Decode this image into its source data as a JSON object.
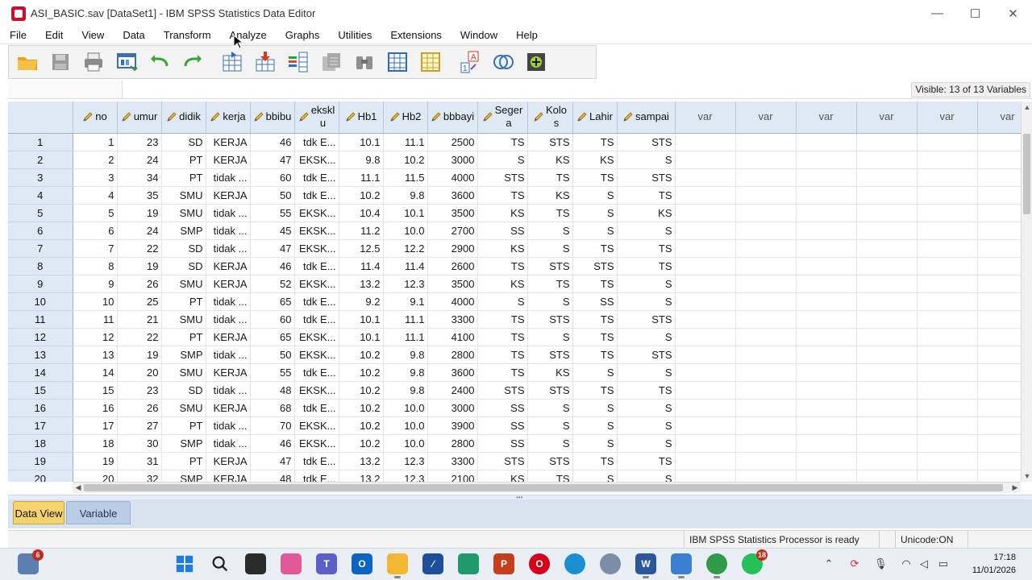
{
  "window": {
    "title": "ASI_BASIC.sav [DataSet1] - IBM SPSS Statistics Data Editor",
    "minimize": "—",
    "maximize": "☐",
    "close": "✕"
  },
  "menu": [
    "File",
    "Edit",
    "View",
    "Data",
    "Transform",
    "Analyze",
    "Graphs",
    "Utilities",
    "Extensions",
    "Window",
    "Help"
  ],
  "toolbar_icons": [
    "open-folder-icon",
    "save-icon",
    "print-icon",
    "dialog-recall-icon",
    "undo-icon",
    "redo-icon",
    "goto-case-icon",
    "goto-variable-icon",
    "variables-icon",
    "run-descriptives-icon",
    "find-icon",
    "insert-cases-icon",
    "insert-variable-icon",
    "split-file-icon",
    "value-labels-icon",
    "use-sets-icon",
    "customize-icon"
  ],
  "status": {
    "visible": "Visible: 13 of 13 Variables",
    "processor": "IBM SPSS Statistics Processor is ready",
    "unicode": "Unicode:ON"
  },
  "tabs": {
    "data_view": "Data View",
    "variable_view": "Variable View"
  },
  "columns": [
    {
      "name": "no",
      "line1": "no",
      "line2": ""
    },
    {
      "name": "umur",
      "line1": "umur",
      "line2": ""
    },
    {
      "name": "didik",
      "line1": "didik",
      "line2": ""
    },
    {
      "name": "kerja",
      "line1": "kerja",
      "line2": ""
    },
    {
      "name": "bbibu",
      "line1": "bbibu",
      "line2": ""
    },
    {
      "name": "ekskl",
      "line1": "ekskl",
      "line2": "u"
    },
    {
      "name": "Hb1",
      "line1": "Hb1",
      "line2": ""
    },
    {
      "name": "Hb2",
      "line1": "Hb2",
      "line2": ""
    },
    {
      "name": "bbbayi",
      "line1": "bbbayi",
      "line2": ""
    },
    {
      "name": "Segera",
      "line1": "Seger",
      "line2": "a"
    },
    {
      "name": "Kolos",
      "line1": "Kolo",
      "line2": "s"
    },
    {
      "name": "Lahir",
      "line1": "Lahir",
      "line2": ""
    },
    {
      "name": "sampai",
      "line1": "sampai",
      "line2": ""
    }
  ],
  "empty_col_label": "var",
  "rows": [
    [
      "1",
      "1",
      "23",
      "SD",
      "KERJA",
      "46",
      "tdk E...",
      "10.1",
      "11.1",
      "2500",
      "TS",
      "STS",
      "TS",
      "STS"
    ],
    [
      "2",
      "2",
      "24",
      "PT",
      "KERJA",
      "47",
      "EKSK...",
      "9.8",
      "10.2",
      "3000",
      "S",
      "KS",
      "KS",
      "S"
    ],
    [
      "3",
      "3",
      "34",
      "PT",
      "tidak ...",
      "60",
      "tdk E...",
      "11.1",
      "11.5",
      "4000",
      "STS",
      "TS",
      "TS",
      "STS"
    ],
    [
      "4",
      "4",
      "35",
      "SMU",
      "KERJA",
      "50",
      "tdk E...",
      "10.2",
      "9.8",
      "3600",
      "TS",
      "KS",
      "S",
      "TS"
    ],
    [
      "5",
      "5",
      "19",
      "SMU",
      "tidak ...",
      "55",
      "EKSK...",
      "10.4",
      "10.1",
      "3500",
      "KS",
      "TS",
      "S",
      "KS"
    ],
    [
      "6",
      "6",
      "24",
      "SMP",
      "tidak ...",
      "45",
      "EKSK...",
      "11.2",
      "10.0",
      "2700",
      "SS",
      "S",
      "S",
      "S"
    ],
    [
      "7",
      "7",
      "22",
      "SD",
      "tidak ...",
      "47",
      "EKSK...",
      "12.5",
      "12.2",
      "2900",
      "KS",
      "S",
      "TS",
      "TS"
    ],
    [
      "8",
      "8",
      "19",
      "SD",
      "KERJA",
      "46",
      "tdk E...",
      "11.4",
      "11.4",
      "2600",
      "TS",
      "STS",
      "STS",
      "TS"
    ],
    [
      "9",
      "9",
      "26",
      "SMU",
      "KERJA",
      "52",
      "EKSK...",
      "13.2",
      "12.3",
      "3500",
      "KS",
      "TS",
      "TS",
      "S"
    ],
    [
      "10",
      "10",
      "25",
      "PT",
      "tidak ...",
      "65",
      "tdk E...",
      "9.2",
      "9.1",
      "4000",
      "S",
      "S",
      "SS",
      "S"
    ],
    [
      "11",
      "11",
      "21",
      "SMU",
      "tidak ...",
      "60",
      "tdk E...",
      "10.1",
      "11.1",
      "3300",
      "TS",
      "STS",
      "TS",
      "STS"
    ],
    [
      "12",
      "12",
      "22",
      "PT",
      "KERJA",
      "65",
      "EKSK...",
      "10.1",
      "11.1",
      "4100",
      "TS",
      "S",
      "TS",
      "S"
    ],
    [
      "13",
      "13",
      "19",
      "SMP",
      "tidak ...",
      "50",
      "EKSK...",
      "10.2",
      "9.8",
      "2800",
      "TS",
      "STS",
      "TS",
      "STS"
    ],
    [
      "14",
      "14",
      "20",
      "SMU",
      "KERJA",
      "55",
      "tdk E...",
      "10.2",
      "9.8",
      "3600",
      "TS",
      "KS",
      "S",
      "S"
    ],
    [
      "15",
      "15",
      "23",
      "SD",
      "tidak ...",
      "48",
      "EKSK...",
      "10.2",
      "9.8",
      "2400",
      "STS",
      "STS",
      "TS",
      "TS"
    ],
    [
      "16",
      "16",
      "26",
      "SMU",
      "KERJA",
      "68",
      "tdk E...",
      "10.2",
      "10.0",
      "3000",
      "SS",
      "S",
      "S",
      "S"
    ],
    [
      "17",
      "17",
      "27",
      "PT",
      "tidak ...",
      "70",
      "EKSK...",
      "10.2",
      "10.0",
      "3900",
      "SS",
      "S",
      "S",
      "S"
    ],
    [
      "18",
      "18",
      "30",
      "SMP",
      "tidak ...",
      "46",
      "EKSK...",
      "10.2",
      "10.0",
      "2800",
      "SS",
      "S",
      "S",
      "S"
    ],
    [
      "19",
      "19",
      "31",
      "PT",
      "KERJA",
      "47",
      "tdk E...",
      "13.2",
      "12.3",
      "3300",
      "STS",
      "STS",
      "TS",
      "TS"
    ],
    [
      "20",
      "20",
      "32",
      "SMP",
      "KERJA",
      "48",
      "tdk E...",
      "13.2",
      "12.3",
      "2100",
      "KS",
      "TS",
      "S",
      "S"
    ]
  ],
  "taskbar": {
    "weather_badge": "6",
    "whatsapp_badge": "18",
    "time": "17:18",
    "date": "11/01/2026"
  },
  "colors": {
    "header_bg": "#dfe9f5",
    "active_tab": "#f7d36b",
    "inactive_tab": "#b8cde6"
  }
}
